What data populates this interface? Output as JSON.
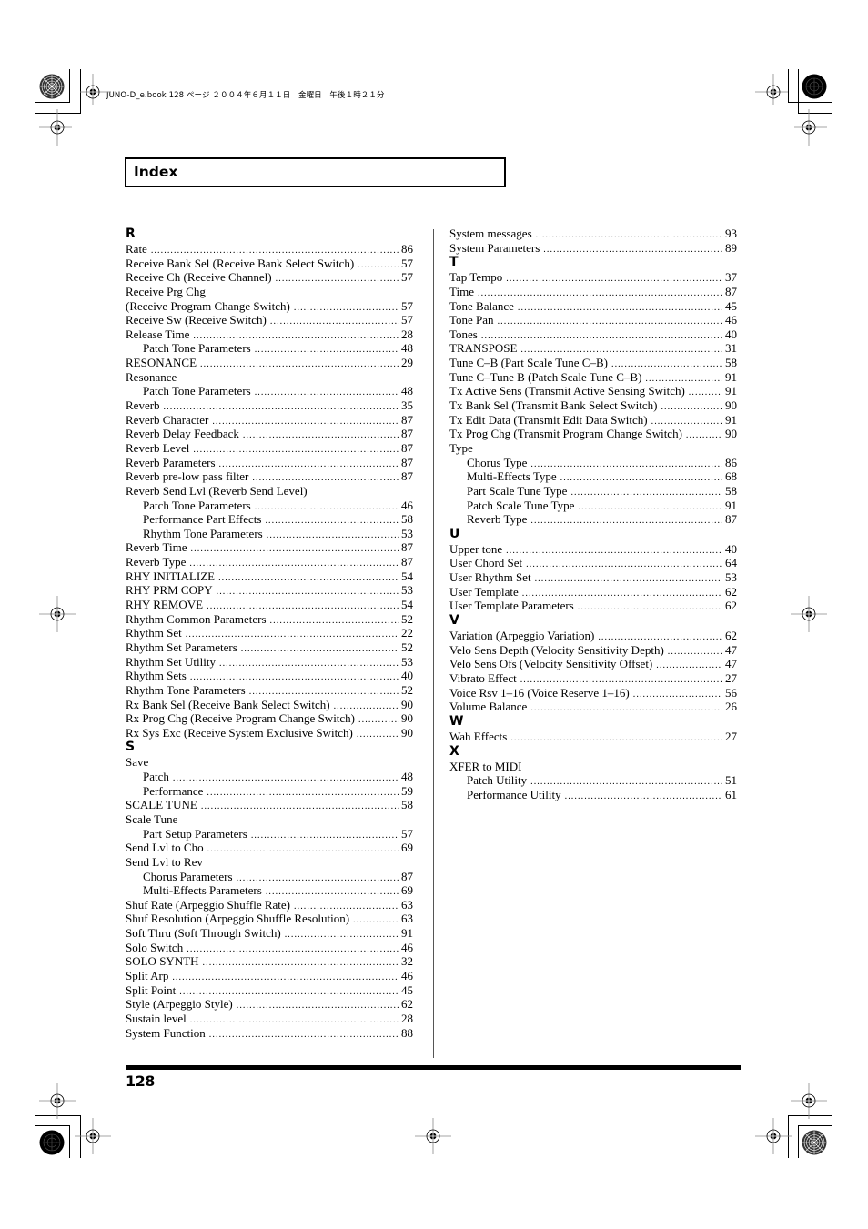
{
  "print_slug": "JUNO-D_e.book  128 ページ  ２００４年６月１１日　金曜日　午後１時２１分",
  "header": {
    "title": "Index"
  },
  "footer": {
    "page_number": "128"
  },
  "icons": {
    "registration_mark": "crosshair-circle-icon",
    "color_target": "radial-target-icon"
  },
  "columns": {
    "left": [
      {
        "letter": "R",
        "entries": [
          {
            "label": "Rate",
            "page": "86"
          },
          {
            "label": "Receive Bank Sel (Receive Bank Select Switch)",
            "page": "57"
          },
          {
            "label": "Receive Ch (Receive Channel)",
            "page": "57"
          },
          {
            "label": "Receive Prg Chg",
            "page": null
          },
          {
            "label": "(Receive Program Change Switch)",
            "page": "57"
          },
          {
            "label": "Receive Sw (Receive Switch)",
            "page": "57"
          },
          {
            "label": "Release Time",
            "page": "28"
          },
          {
            "label": "Patch Tone Parameters",
            "page": "48",
            "sub": true
          },
          {
            "label": "RESONANCE",
            "page": "29"
          },
          {
            "label": "Resonance",
            "page": null
          },
          {
            "label": "Patch Tone Parameters",
            "page": "48",
            "sub": true
          },
          {
            "label": "Reverb",
            "page": "35"
          },
          {
            "label": "Reverb Character",
            "page": "87"
          },
          {
            "label": "Reverb Delay Feedback",
            "page": "87"
          },
          {
            "label": "Reverb Level",
            "page": "87"
          },
          {
            "label": "Reverb Parameters",
            "page": "87"
          },
          {
            "label": "Reverb pre-low pass filter",
            "page": "87"
          },
          {
            "label": "Reverb Send Lvl (Reverb Send Level)",
            "page": null
          },
          {
            "label": "Patch Tone Parameters",
            "page": "46",
            "sub": true
          },
          {
            "label": "Performance Part Effects",
            "page": "58",
            "sub": true
          },
          {
            "label": "Rhythm Tone Parameters",
            "page": "53",
            "sub": true
          },
          {
            "label": "Reverb Time",
            "page": "87"
          },
          {
            "label": "Reverb Type",
            "page": "87"
          },
          {
            "label": "RHY INITIALIZE",
            "page": "54"
          },
          {
            "label": "RHY PRM COPY",
            "page": "53"
          },
          {
            "label": "RHY REMOVE",
            "page": "54"
          },
          {
            "label": "Rhythm Common Parameters",
            "page": "52"
          },
          {
            "label": "Rhythm Set",
            "page": "22"
          },
          {
            "label": "Rhythm Set Parameters",
            "page": "52"
          },
          {
            "label": "Rhythm Set Utility",
            "page": "53"
          },
          {
            "label": "Rhythm Sets",
            "page": "40"
          },
          {
            "label": "Rhythm Tone Parameters",
            "page": "52"
          },
          {
            "label": "Rx Bank Sel (Receive Bank Select Switch)",
            "page": "90"
          },
          {
            "label": "Rx Prog Chg (Receive Program Change Switch)",
            "page": "90"
          },
          {
            "label": "Rx Sys Exc (Receive System Exclusive Switch)",
            "page": "90"
          }
        ]
      },
      {
        "letter": "S",
        "entries": [
          {
            "label": "Save",
            "page": null
          },
          {
            "label": "Patch",
            "page": "48",
            "sub": true
          },
          {
            "label": "Performance",
            "page": "59",
            "sub": true
          },
          {
            "label": "SCALE TUNE",
            "page": "58"
          },
          {
            "label": "Scale Tune",
            "page": null
          },
          {
            "label": "Part Setup Parameters",
            "page": "57",
            "sub": true
          },
          {
            "label": "Send Lvl to Cho",
            "page": "69"
          },
          {
            "label": "Send Lvl to Rev",
            "page": null
          },
          {
            "label": "Chorus Parameters",
            "page": "87",
            "sub": true
          },
          {
            "label": "Multi-Effects Parameters",
            "page": "69",
            "sub": true
          },
          {
            "label": "Shuf Rate (Arpeggio Shuffle Rate)",
            "page": "63"
          },
          {
            "label": "Shuf Resolution (Arpeggio Shuffle Resolution)",
            "page": "63"
          },
          {
            "label": "Soft Thru (Soft Through Switch)",
            "page": "91"
          },
          {
            "label": "Solo Switch",
            "page": "46"
          },
          {
            "label": "SOLO SYNTH",
            "page": "32"
          },
          {
            "label": "Split Arp",
            "page": "46"
          },
          {
            "label": "Split Point",
            "page": "45"
          },
          {
            "label": "Style (Arpeggio Style)",
            "page": "62"
          },
          {
            "label": "Sustain level",
            "page": "28"
          },
          {
            "label": "System Function",
            "page": "88"
          }
        ]
      }
    ],
    "right": [
      {
        "letter": null,
        "entries": [
          {
            "label": "System messages",
            "page": "93"
          },
          {
            "label": "System Parameters",
            "page": "89"
          }
        ]
      },
      {
        "letter": "T",
        "entries": [
          {
            "label": "Tap Tempo",
            "page": "37"
          },
          {
            "label": "Time",
            "page": "87"
          },
          {
            "label": "Tone Balance",
            "page": "45"
          },
          {
            "label": "Tone Pan",
            "page": "46"
          },
          {
            "label": "Tones",
            "page": "40"
          },
          {
            "label": "TRANSPOSE",
            "page": "31"
          },
          {
            "label": "Tune C–B (Part Scale Tune C–B)",
            "page": "58"
          },
          {
            "label": "Tune C–Tune B (Patch Scale Tune C–B)",
            "page": "91"
          },
          {
            "label": "Tx Active Sens (Transmit Active Sensing Switch)",
            "page": "91"
          },
          {
            "label": "Tx Bank Sel (Transmit Bank Select Switch)",
            "page": "90"
          },
          {
            "label": "Tx Edit Data (Transmit Edit Data Switch)",
            "page": "91"
          },
          {
            "label": "Tx Prog Chg (Transmit Program Change Switch)",
            "page": "90"
          },
          {
            "label": "Type",
            "page": null
          },
          {
            "label": "Chorus Type",
            "page": "86",
            "sub": true
          },
          {
            "label": "Multi-Effects Type",
            "page": "68",
            "sub": true
          },
          {
            "label": "Part Scale Tune Type",
            "page": "58",
            "sub": true
          },
          {
            "label": "Patch Scale Tune Type",
            "page": "91",
            "sub": true
          },
          {
            "label": "Reverb Type",
            "page": "87",
            "sub": true
          }
        ]
      },
      {
        "letter": "U",
        "entries": [
          {
            "label": "Upper tone",
            "page": "40"
          },
          {
            "label": "User Chord Set",
            "page": "64"
          },
          {
            "label": "User Rhythm Set",
            "page": "53"
          },
          {
            "label": "User Template",
            "page": "62"
          },
          {
            "label": "User Template Parameters",
            "page": "62"
          }
        ]
      },
      {
        "letter": "V",
        "entries": [
          {
            "label": "Variation (Arpeggio Variation)",
            "page": "62"
          },
          {
            "label": "Velo Sens Depth (Velocity Sensitivity Depth)",
            "page": "47"
          },
          {
            "label": "Velo Sens Ofs (Velocity Sensitivity Offset)",
            "page": "47"
          },
          {
            "label": "Vibrato Effect",
            "page": "27"
          },
          {
            "label": "Voice Rsv 1–16 (Voice Reserve 1–16)",
            "page": "56"
          },
          {
            "label": "Volume Balance",
            "page": "26"
          }
        ]
      },
      {
        "letter": "W",
        "entries": [
          {
            "label": "Wah Effects",
            "page": "27"
          }
        ]
      },
      {
        "letter": "X",
        "entries": [
          {
            "label": "XFER to MIDI",
            "page": null
          },
          {
            "label": "Patch Utility",
            "page": "51",
            "sub": true
          },
          {
            "label": "Performance Utility",
            "page": "61",
            "sub": true
          }
        ]
      }
    ]
  }
}
